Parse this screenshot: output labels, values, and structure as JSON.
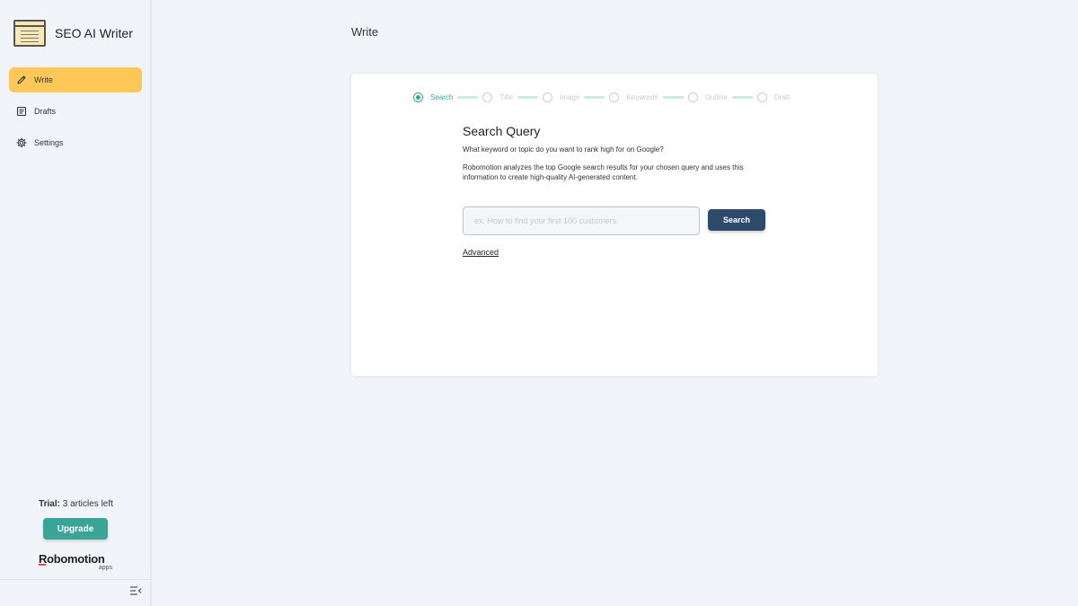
{
  "app": {
    "title": "SEO AI Writer"
  },
  "sidebar": {
    "items": [
      {
        "label": "Write",
        "icon": "pencil-icon",
        "active": true
      },
      {
        "label": "Drafts",
        "icon": "document-icon",
        "active": false
      },
      {
        "label": "Settings",
        "icon": "gear-icon",
        "active": false
      }
    ],
    "trial": {
      "prefix": "Trial:",
      "count": "3",
      "suffix": "articles left"
    },
    "upgrade_label": "Upgrade",
    "brand": {
      "name": "Robomotion",
      "sub": "apps"
    }
  },
  "page": {
    "title": "Write"
  },
  "stepper": {
    "steps": [
      "Search",
      "Title",
      "Image",
      "Keywords",
      "Outline",
      "Draft"
    ],
    "active_index": 0
  },
  "form": {
    "title": "Search Query",
    "question": "What keyword or topic do you want to rank high for on Google?",
    "description": "Robomotion analyzes the top Google search results for your chosen query and uses this information to create high-quality AI-generated content.",
    "input_placeholder": "ex. How to find your first 100 customers",
    "input_value": "",
    "search_label": "Search",
    "advanced_label": "Advanced"
  },
  "colors": {
    "accent_yellow": "#fdc857",
    "accent_teal": "#3aa597",
    "button_navy": "#2e4a6b",
    "background": "#f1f4f9"
  }
}
